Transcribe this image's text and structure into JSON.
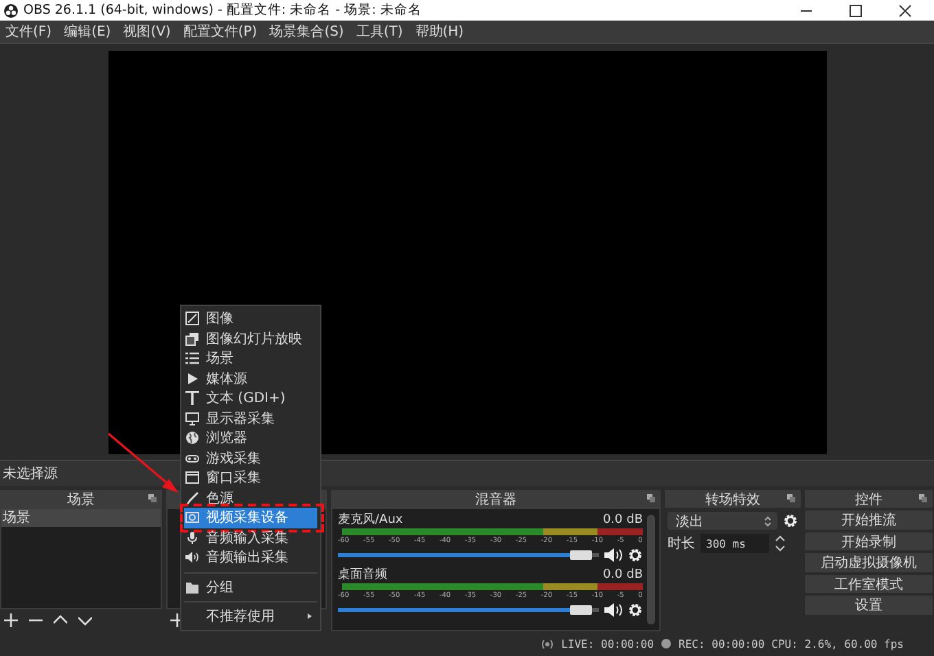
{
  "window": {
    "title": "OBS 26.1.1 (64-bit, windows) - 配置文件: 未命名 - 场景: 未命名"
  },
  "menu_bar": [
    "文件(F)",
    "编辑(E)",
    "视图(V)",
    "配置文件(P)",
    "场景集合(S)",
    "工具(T)",
    "帮助(H)"
  ],
  "source_bar": {
    "label": "未选择源"
  },
  "scenes": {
    "title": "场景",
    "items": [
      {
        "label": "场景",
        "selected": true
      }
    ]
  },
  "context_menu": {
    "groups": [
      [
        {
          "label": "图像",
          "selected": false
        },
        {
          "label": "图像幻灯片放映",
          "selected": false
        },
        {
          "label": "场景",
          "selected": false
        },
        {
          "label": "媒体源",
          "selected": false
        },
        {
          "label": "文本 (GDI+)",
          "selected": false
        },
        {
          "label": "显示器采集",
          "selected": false
        },
        {
          "label": "浏览器",
          "selected": false
        },
        {
          "label": "游戏采集",
          "selected": false
        },
        {
          "label": "窗口采集",
          "selected": false
        },
        {
          "label": "色源",
          "selected": false
        },
        {
          "label": "视频采集设备",
          "selected": true
        },
        {
          "label": "音频输入采集",
          "selected": false
        },
        {
          "label": "音频输出采集",
          "selected": false
        }
      ],
      [
        {
          "label": "分组",
          "selected": false
        }
      ],
      [
        {
          "label": "不推荐使用",
          "selected": false
        }
      ]
    ]
  },
  "mixer": {
    "title": "混音器",
    "channels": [
      {
        "name": "麦克风/Aux",
        "reading": "0.0 dB",
        "level": 0.93,
        "ticks": [
          "-60",
          "-55",
          "-50",
          "-45",
          "-40",
          "-35",
          "-30",
          "-25",
          "-20",
          "-15",
          "-10",
          "-5",
          "0"
        ]
      },
      {
        "name": "桌面音频",
        "reading": "0.0 dB",
        "level": 0.93,
        "ticks": [
          "-60",
          "-55",
          "-50",
          "-45",
          "-40",
          "-35",
          "-30",
          "-25",
          "-20",
          "-15",
          "-10",
          "-5",
          "0"
        ]
      }
    ]
  },
  "transitions": {
    "title": "转场特效",
    "selected": "淡出",
    "duration_label": "时长",
    "duration": "300 ms"
  },
  "controls": {
    "title": "控件",
    "buttons": [
      "开始推流",
      "开始录制",
      "启动虚拟摄像机",
      "工作室模式",
      "设置"
    ]
  },
  "status_bar": {
    "live": "LIVE: 00:00:00",
    "rec": "REC: 00:00:00",
    "stats": "CPU: 2.6%, 60.00 fps"
  }
}
